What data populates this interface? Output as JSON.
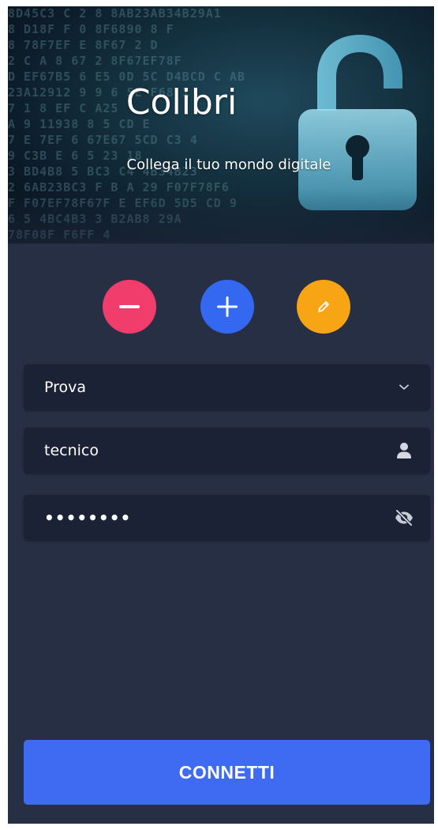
{
  "header": {
    "title": "Colibri",
    "subtitle": "Collega il tuo mondo digitale",
    "background_hex": [
      "  8D45C3 C        2 8 8AB23AB34B29A1",
      "  8 D18F      F   0 8F6890 8    F",
      " 8 78F7EF      E   8F67 2      D",
      "  2        C A    8 67  2   8F67EF78F",
      " D EF67B5 6  E5  0D   5C D4BCD C AB",
      "   23A12912 9    9 6   5E    F68   1",
      "   7    1       8     EF   C  A25",
      "  A    9 11938        8   5 CD   E",
      "    7  E  7EF 6   67E67  5CD  C3 4",
      "  9      C3B   E  6 5     23  18",
      "  3      BD4B8 5   BC3  C4  4B34B23",
      "  2  6AB23BC3 F    B  A 29 F07F78F6",
      "  F F07EF78F67F   E EF6D  5D5 CD  9",
      "   6  5     4BC4B3 3   B2AB8   29A",
      "         78F08F         F6FF   4    "
    ],
    "colors": {
      "lock": "#6fc9e6"
    }
  },
  "actions": {
    "remove": {
      "icon": "minus-icon",
      "color": "#f03d6b"
    },
    "add": {
      "icon": "plus-icon",
      "color": "#3468f0"
    },
    "edit": {
      "icon": "pencil-icon",
      "color": "#f7a515"
    }
  },
  "form": {
    "profile": {
      "value": "Prova",
      "icon": "chevron-down-icon"
    },
    "username": {
      "value": "tecnico",
      "icon": "user-icon"
    },
    "password": {
      "value": "••••••••",
      "icon": "eye-off-icon"
    }
  },
  "connect_button": {
    "label": "CONNETTI",
    "color": "#3f6af2"
  },
  "theme": {
    "background": "#272f45",
    "field_background": "#1c2235"
  }
}
